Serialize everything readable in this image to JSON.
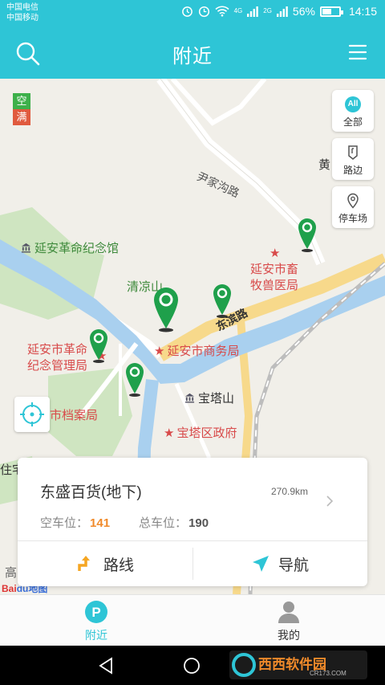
{
  "status_bar": {
    "carrier_1": "中国电信",
    "carrier_2": "中国移动",
    "signal_1": "4G",
    "signal_2": "2G",
    "battery": "56%",
    "battery_fraction": 0.56,
    "time": "14:15"
  },
  "header": {
    "title": "附近",
    "search_icon": "search-icon",
    "menu_icon": "menu-icon"
  },
  "map": {
    "legend": {
      "free": "空",
      "full": "满"
    },
    "side_buttons": {
      "all_badge": "All",
      "all_label": "全部",
      "roadside_label": "路边",
      "parking_label": "停车场"
    },
    "labels": {
      "revolution_memorial": "延安革命纪念馆",
      "qingliang_mountain": "清凉山",
      "animal_hospital_line1": "延安市畜",
      "animal_hospital_line2": "牧兽医局",
      "revolution_mgmt_line1": "延安市革命",
      "revolution_mgmt_line2": "纪念管理局",
      "commerce_bureau": "延安市商务局",
      "baota_mountain": "宝塔山",
      "archives_bureau": "市档案局",
      "baota_government": "宝塔区政府",
      "yinjiagou_road": "尹家沟路",
      "dongbin_road": "东滨路",
      "huang_partial": "黄",
      "zhu_partial": "住宅",
      "gao_partial": "高"
    },
    "baidu_logo": "Bai",
    "baidu_logo_2": "du地图"
  },
  "card": {
    "name": "东盛百货(地下)",
    "distance": "270.9km",
    "free_label": "空车位：",
    "free_count": "141",
    "total_label": "总车位：",
    "total_count": "190",
    "route_label": "路线",
    "nav_label": "导航"
  },
  "tabs": {
    "nearby": "附近",
    "mine": "我的"
  },
  "watermark": {
    "text": "西西软件园",
    "sub": "CR173.COM"
  },
  "colors": {
    "primary": "#2ec5d6",
    "free_green": "#3db04a",
    "full_red": "#e05a3e",
    "count_orange": "#f08a2a",
    "pin_green": "#1fa04b"
  }
}
